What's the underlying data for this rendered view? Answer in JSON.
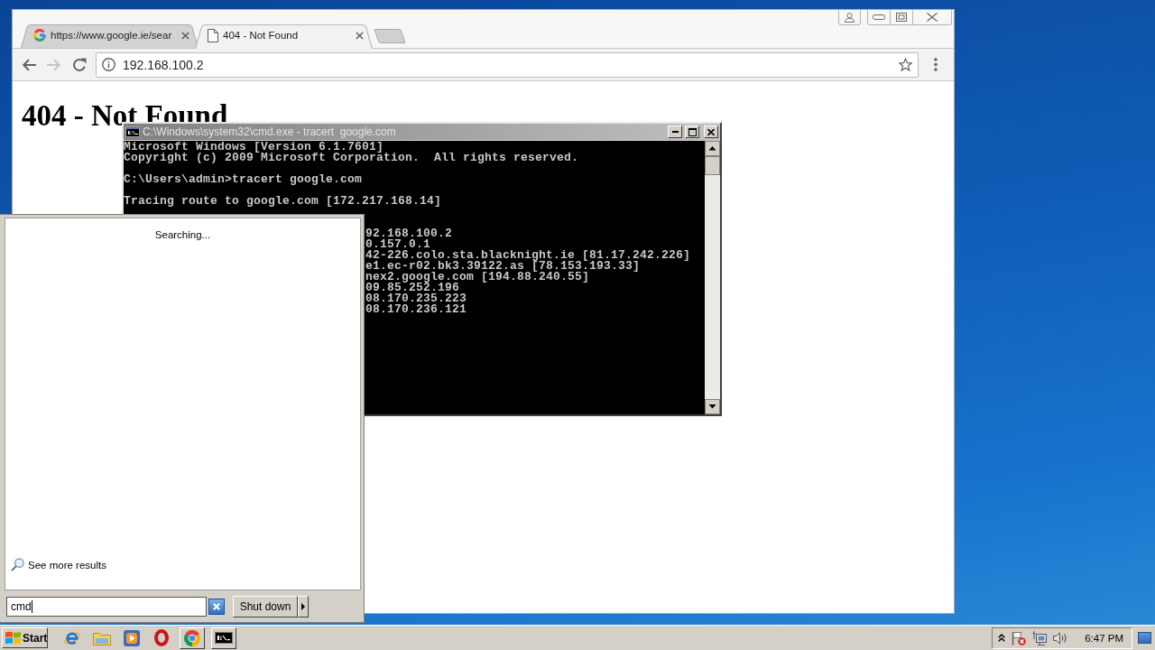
{
  "browser": {
    "tabs": [
      {
        "kind": "google",
        "title": "https://www.google.ie/sear",
        "selected": false
      },
      {
        "kind": "page",
        "title": "404 - Not Found",
        "selected": true
      }
    ],
    "nav": [
      {
        "kind": "back",
        "disabled": false
      },
      {
        "kind": "forward",
        "disabled": true
      },
      {
        "kind": "reload",
        "disabled": false
      }
    ],
    "address": "192.168.100.2",
    "heading": "404 - Not Found"
  },
  "console": {
    "title": "C:\\Windows\\system32\\cmd.exe - tracert  google.com",
    "blocks": [
      [
        "Microsoft Windows [Version 6.1.7601]",
        "Copyright (c) 2009 Microsoft Corporation.  All rights reserved."
      ],
      [
        "C:\\Users\\admin>tracert google.com"
      ],
      [
        "Tracing route to google.com [172.217.168.14]"
      ]
    ],
    "hops": [
      "92.168.100.2",
      "0.157.0.1",
      "42-226.colo.sta.blacknight.ie [81.17.242.226]",
      "e1.ec-r02.bk3.39122.as [78.153.193.33]",
      "nex2.google.com [194.88.240.55]",
      "09.85.252.196",
      "08.170.235.223",
      "08.170.236.121"
    ]
  },
  "start_menu": {
    "status": "Searching...",
    "more_results": "See more results",
    "search": {
      "value": "cmd"
    },
    "shut_down": "Shut down"
  },
  "taskbar": {
    "start": "Start",
    "apps": [
      {
        "kind": "ie",
        "running": false
      },
      {
        "kind": "explorer",
        "running": false
      },
      {
        "kind": "media",
        "running": false
      },
      {
        "kind": "opera",
        "running": false
      },
      {
        "kind": "chrome",
        "running": true
      },
      {
        "kind": "cmd",
        "running": true
      }
    ],
    "clock": "6:47 PM"
  }
}
